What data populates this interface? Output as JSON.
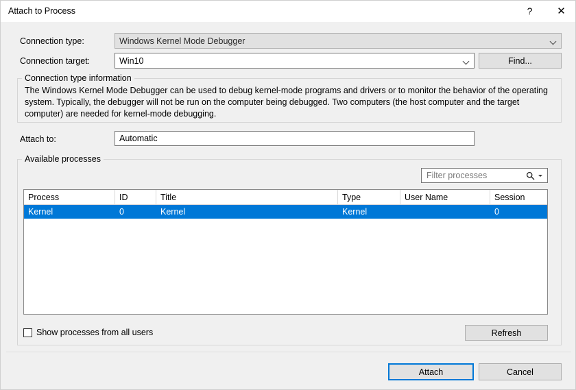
{
  "window": {
    "title": "Attach to Process",
    "help_glyph": "?",
    "close_glyph": "✕"
  },
  "form": {
    "connection_type_label": "Connection type:",
    "connection_type_value": "Windows Kernel Mode Debugger",
    "connection_target_label": "Connection target:",
    "connection_target_value": "Win10",
    "find_button": "Find...",
    "attach_to_label": "Attach to:",
    "attach_to_value": "Automatic"
  },
  "info_group": {
    "title": "Connection type information",
    "text": "The Windows Kernel Mode Debugger can be used to debug kernel-mode programs and drivers or to monitor the behavior of the operating system. Typically, the debugger will not be run on the computer being debugged. Two computers (the host computer and the target computer) are needed for kernel-mode debugging."
  },
  "processes_group": {
    "title": "Available processes",
    "filter_placeholder": "Filter processes",
    "columns": [
      "Process",
      "ID",
      "Title",
      "Type",
      "User Name",
      "Session"
    ],
    "rows": [
      {
        "process": "Kernel",
        "id": "0",
        "title": "Kernel",
        "type": "Kernel",
        "user_name": "",
        "session": "0",
        "selected": true
      }
    ],
    "show_all_users_label": "Show processes from all users",
    "show_all_users_checked": false,
    "refresh_button": "Refresh"
  },
  "footer": {
    "attach_button": "Attach",
    "cancel_button": "Cancel"
  },
  "colors": {
    "accent": "#0078D7",
    "dialog_bg": "#F0F0F0",
    "selection_bg": "#0078D7",
    "disabled_field_bg": "#E1E1E1"
  }
}
